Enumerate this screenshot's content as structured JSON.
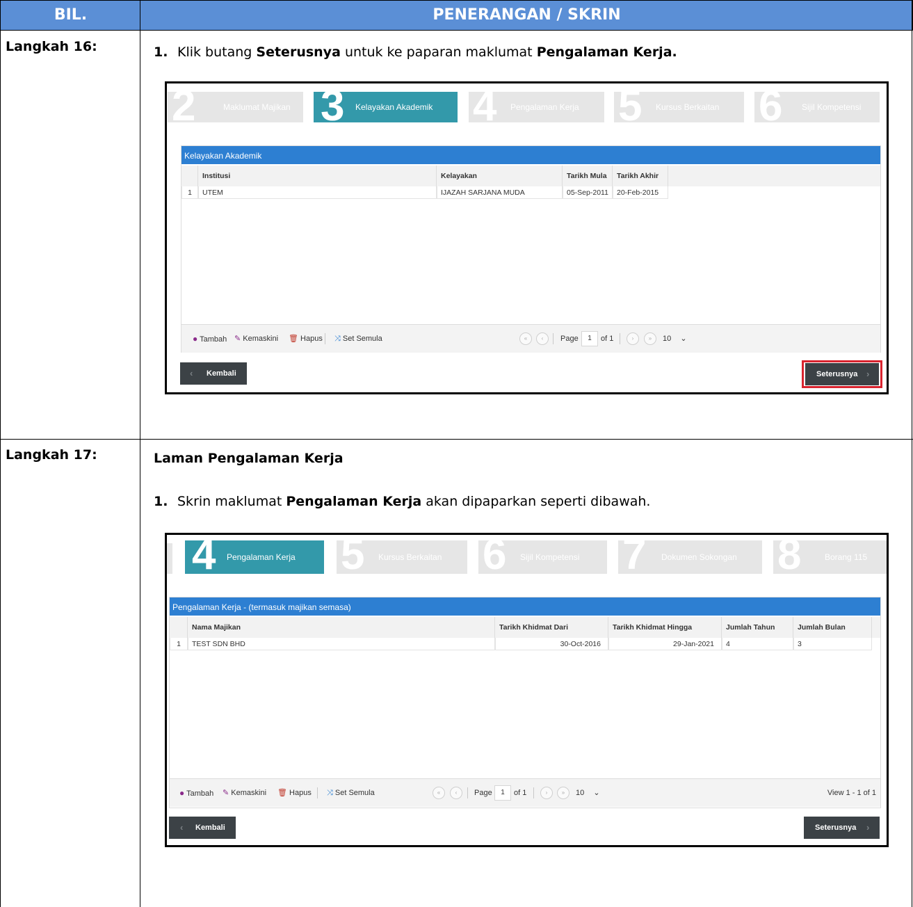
{
  "header": {
    "col1": "BIL.",
    "col2": "PENERANGAN / SKRIN"
  },
  "step16": {
    "label": "Langkah 16:",
    "instr_num": "1.",
    "instr_pre": "Klik butang",
    "instr_bold1": "Seterusnya",
    "instr_mid": "untuk ke paparan maklumat",
    "instr_bold2": "Pengalaman Kerja.",
    "screen": {
      "wizard": [
        {
          "num": "2",
          "label": "Maklumat Majikan"
        },
        {
          "num": "3",
          "label": "Kelayakan Akademik"
        },
        {
          "num": "4",
          "label": "Pengalaman Kerja"
        },
        {
          "num": "5",
          "label": "Kursus Berkaitan"
        },
        {
          "num": "6",
          "label": "Sijil Kompetensi"
        }
      ],
      "active_step": "3",
      "grid_title": "Kelayakan Akademik",
      "columns": [
        "Institusi",
        "Kelayakan",
        "Tarikh Mula",
        "Tarikh Akhir"
      ],
      "rows": [
        {
          "no": "1",
          "cells": [
            "UTEM",
            "IJAZAH SARJANA MUDA",
            "05-Sep-2011",
            "20-Feb-2015"
          ]
        }
      ],
      "pager": {
        "add": "Tambah",
        "edit": "Kemaskini",
        "delete": "Hapus",
        "reset": "Set Semula",
        "page_label": "Page",
        "page": "1",
        "of": "of 1",
        "size": "10"
      },
      "back": "Kembali",
      "next": "Seterusnya"
    }
  },
  "step17": {
    "label": "Langkah 17:",
    "heading": "Laman Pengalaman Kerja",
    "instr_num": "1.",
    "instr_pre": "Skrin maklumat",
    "instr_bold": "Pengalaman Kerja",
    "instr_post": "akan dipaparkan seperti dibawah.",
    "screen": {
      "wizard": [
        {
          "num": "4",
          "label": "Pengalaman Kerja"
        },
        {
          "num": "5",
          "label": "Kursus Berkaitan"
        },
        {
          "num": "6",
          "label": "Sijil Kompetensi"
        },
        {
          "num": "7",
          "label": "Dokumen Sokongan"
        },
        {
          "num": "8",
          "label": "Borang 115"
        }
      ],
      "active_step": "4",
      "grid_title": "Pengalaman Kerja - (termasuk majikan semasa)",
      "columns": [
        "Nama Majikan",
        "Tarikh Khidmat Dari",
        "Tarikh Khidmat Hingga",
        "Jumlah Tahun",
        "Jumlah Bulan"
      ],
      "rows": [
        {
          "no": "1",
          "cells": [
            "TEST SDN BHD",
            "30-Oct-2016",
            "29-Jan-2021",
            "4",
            "3"
          ]
        }
      ],
      "pager": {
        "add": "Tambah",
        "edit": "Kemaskini",
        "delete": "Hapus",
        "reset": "Set Semula",
        "page_label": "Page",
        "page": "1",
        "of": "of 1",
        "size": "10",
        "view": "View 1 - 1 of 1"
      },
      "back": "Kembali",
      "next": "Seterusnya"
    }
  }
}
